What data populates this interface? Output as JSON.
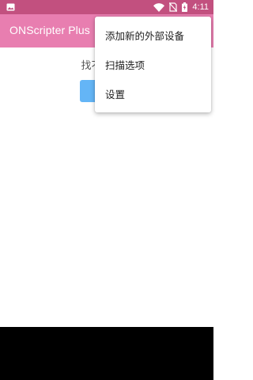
{
  "status_bar": {
    "time": "4:11",
    "icons": [
      "image-notification-icon",
      "wifi-icon",
      "no-sim-icon",
      "battery-charging-icon"
    ]
  },
  "app_bar": {
    "title": "ONScripter Plus"
  },
  "main": {
    "empty_message": "找不到游戏",
    "button_label": ""
  },
  "overflow_menu": {
    "items": [
      {
        "label": "添加新的外部设备"
      },
      {
        "label": "扫描选项"
      },
      {
        "label": "设置"
      }
    ]
  },
  "colors": {
    "status_bar": "#c2507f",
    "app_bar": "#e87eb0",
    "button": "#64b5f6"
  }
}
